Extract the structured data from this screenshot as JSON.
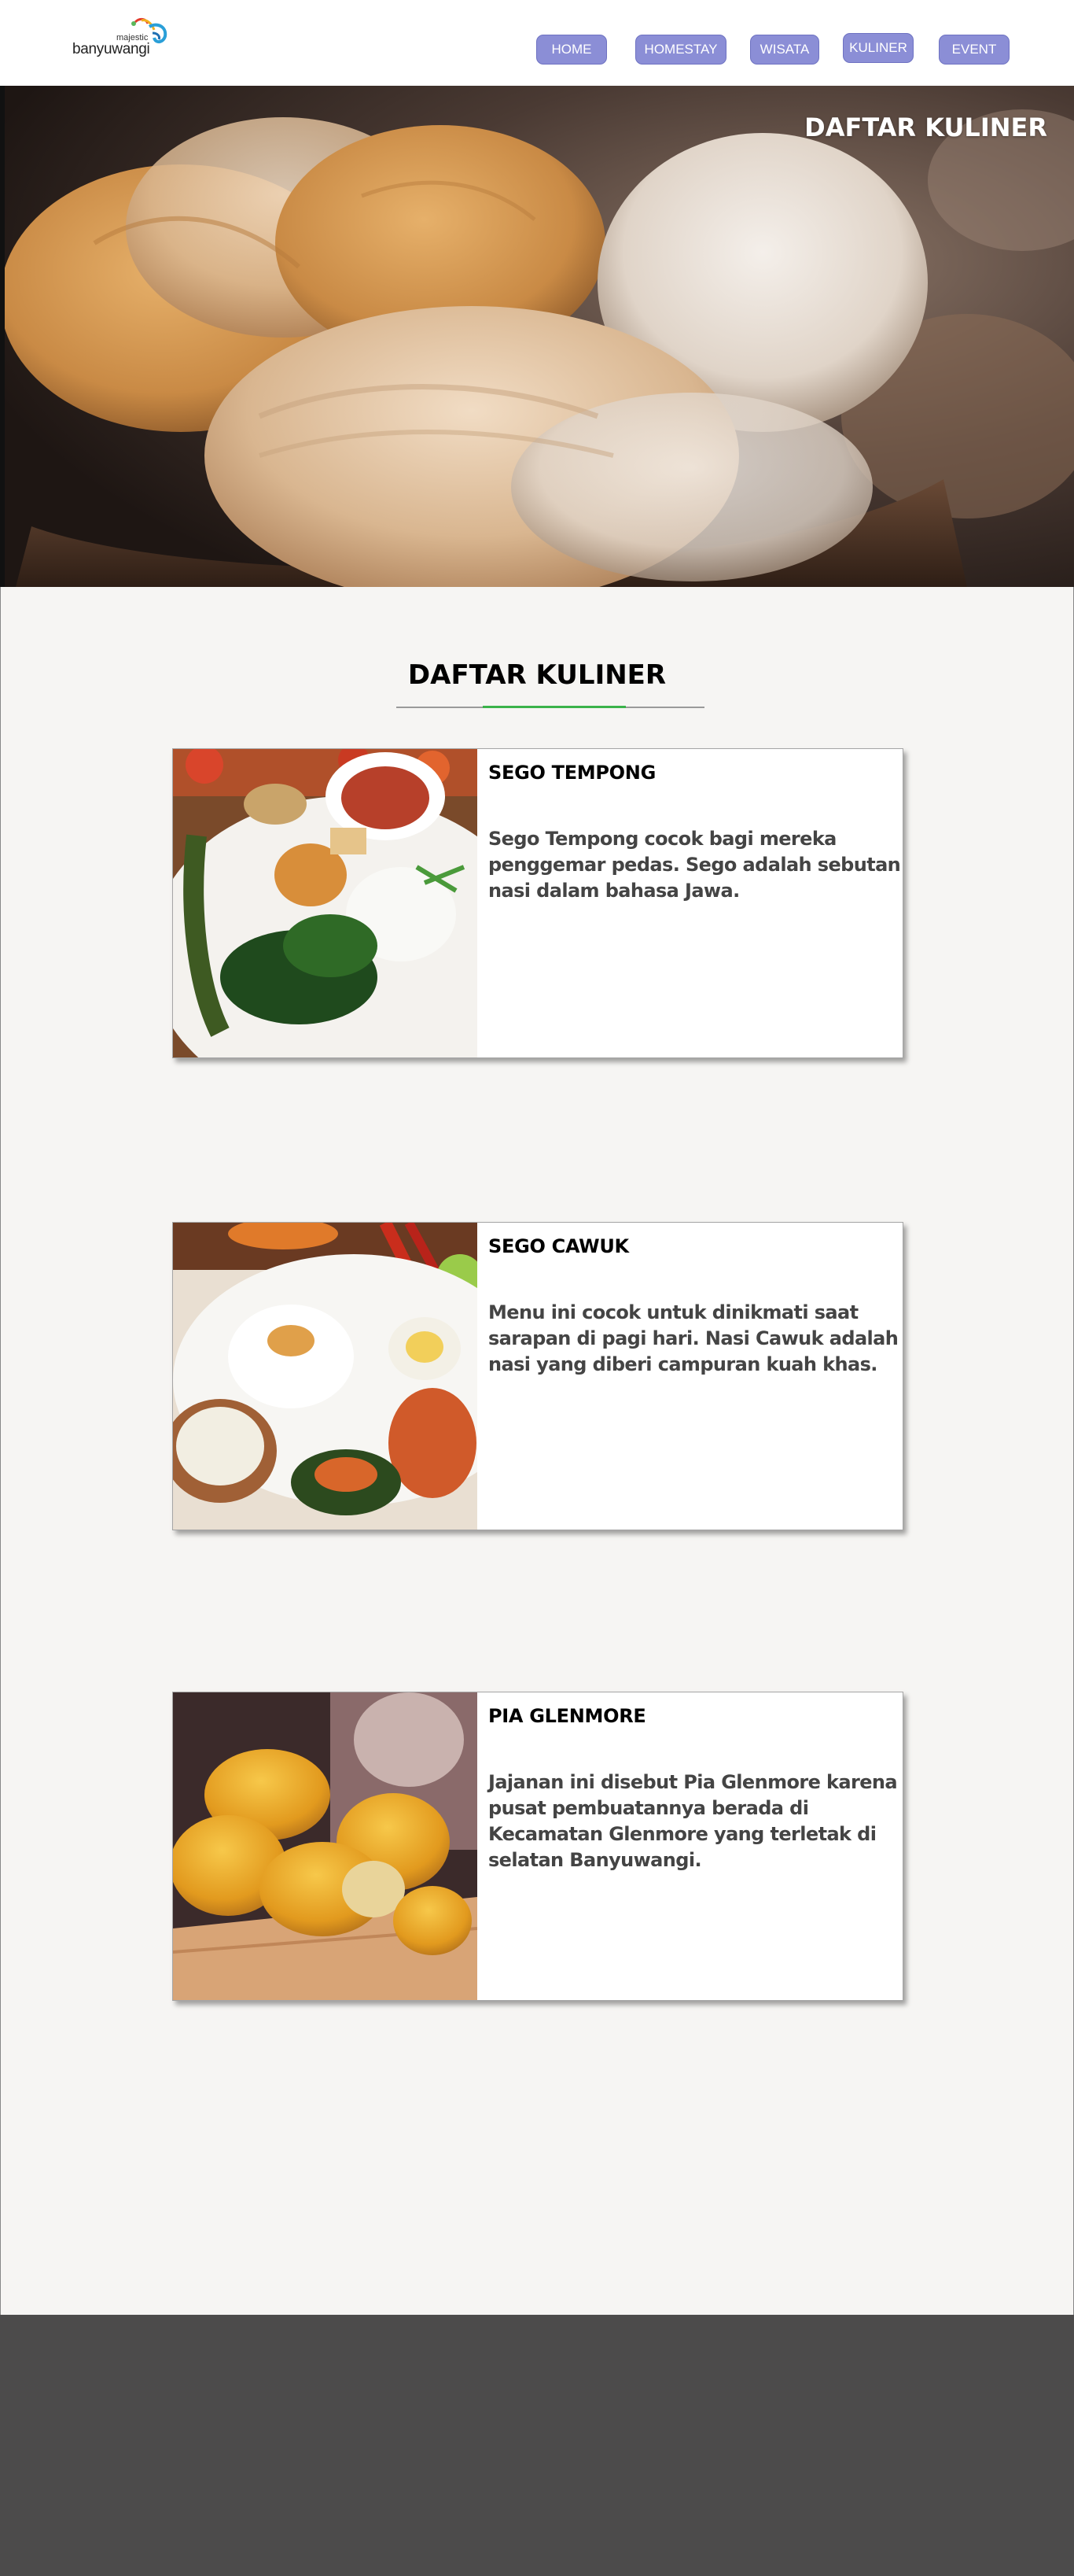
{
  "header": {
    "logo": {
      "small_text": "majestic",
      "main_text": "banyuwangi"
    },
    "nav": [
      {
        "label": "HOME"
      },
      {
        "label": "HOMESTAY"
      },
      {
        "label": "WISATA"
      },
      {
        "label": "KULINER"
      },
      {
        "label": "EVENT"
      }
    ]
  },
  "hero": {
    "title": "DAFTAR KULINER"
  },
  "main": {
    "section_title": "DAFTAR KULINER",
    "items": [
      {
        "name": "SEGO TEMPONG",
        "description": "Sego Tempong cocok bagi mereka penggemar pedas. Sego adalah sebutan nasi dalam bahasa Jawa."
      },
      {
        "name": "SEGO CAWUK",
        "description": "Menu ini cocok untuk dinikmati saat sarapan di pagi hari. Nasi Cawuk adalah nasi yang diberi campuran kuah khas."
      },
      {
        "name": "PIA GLENMORE",
        "description": "Jajanan ini disebut Pia Glenmore karena pusat pembuatannya berada di Kecamatan Glenmore yang terletak di selatan Banyuwangi."
      }
    ]
  },
  "colors": {
    "nav_button": "#8b8ed6",
    "accent_line": "#3bb34a",
    "page_background": "#f6f5f3",
    "footer": "#4c4b4b"
  }
}
